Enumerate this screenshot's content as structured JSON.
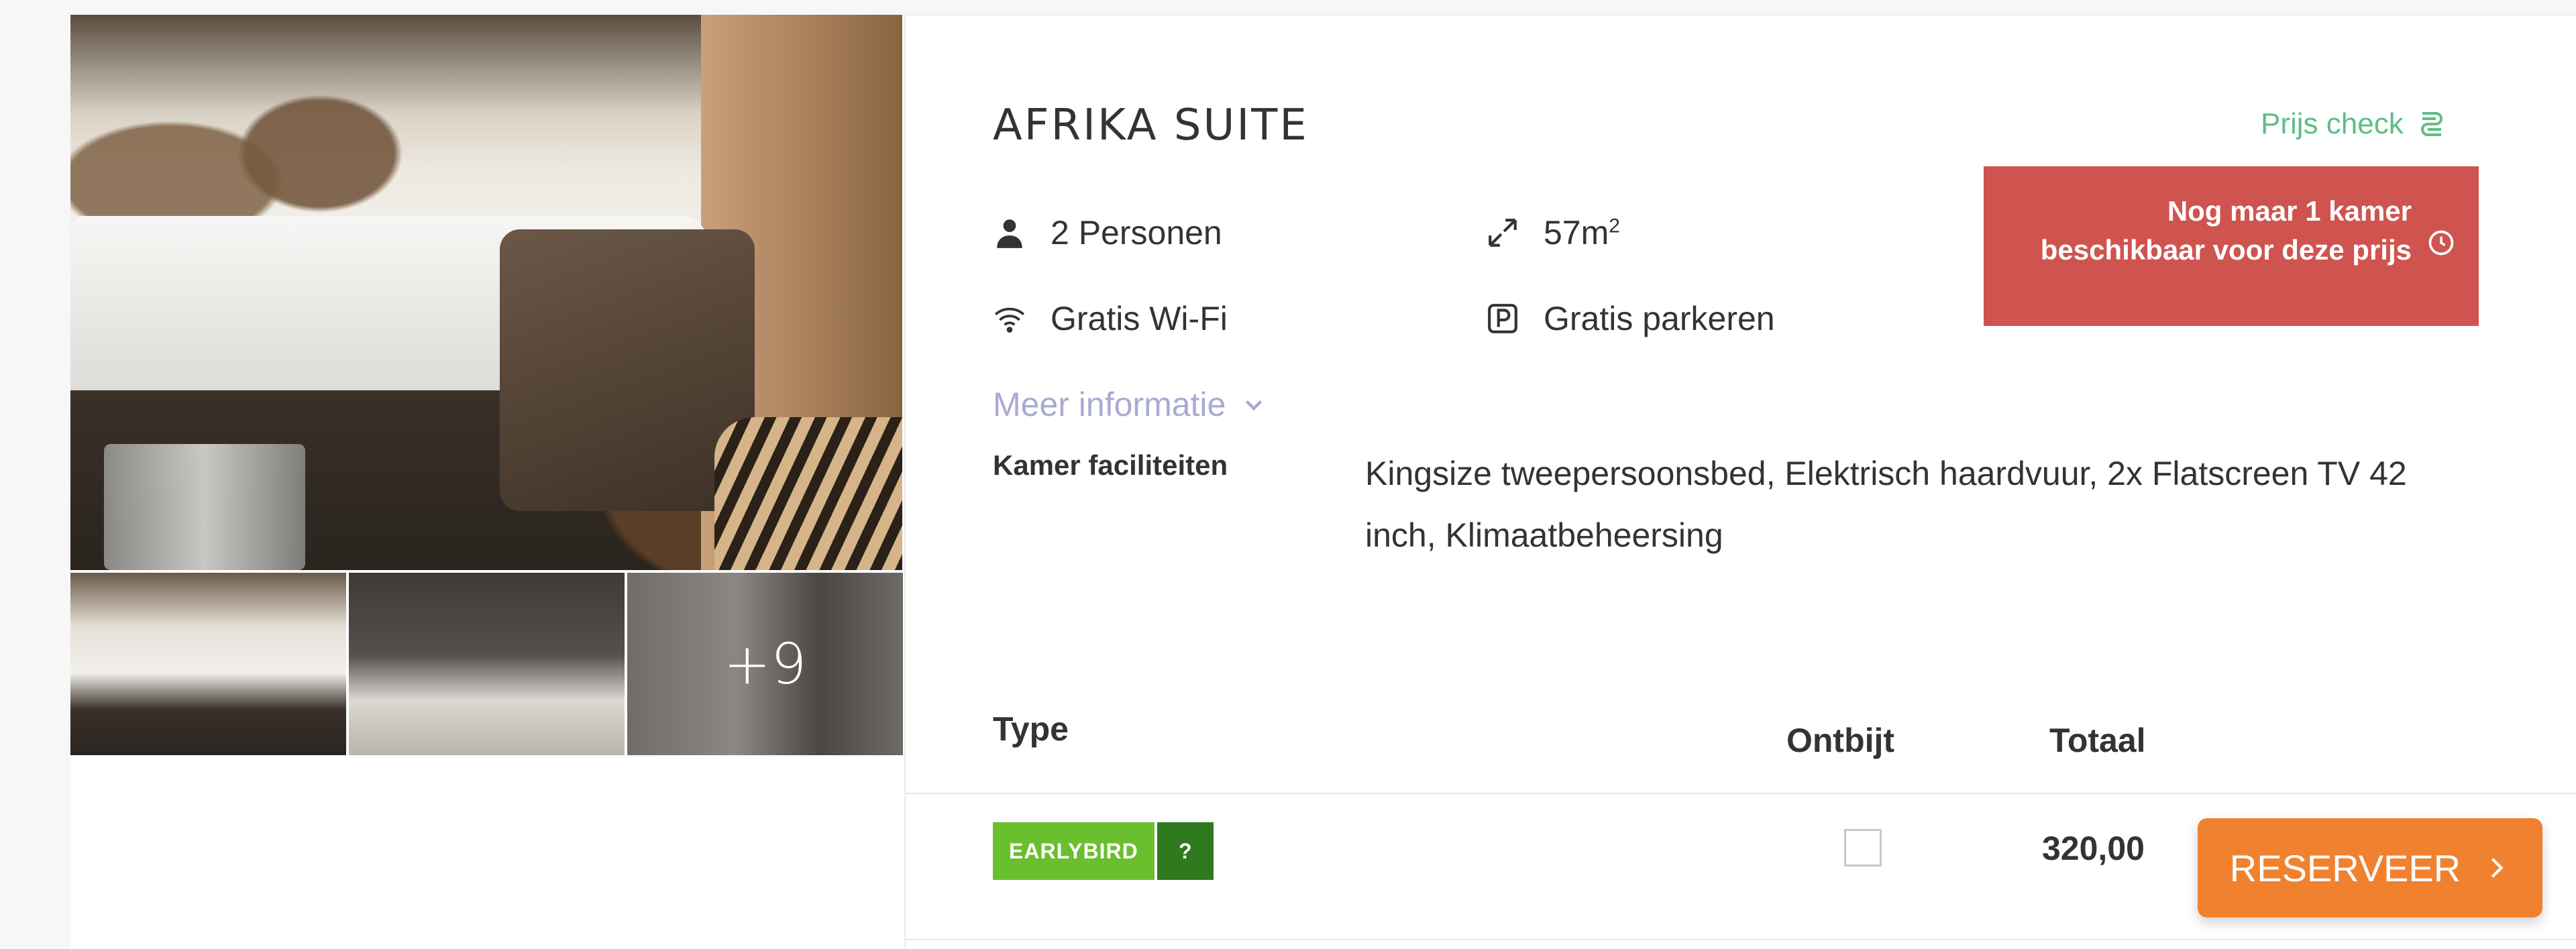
{
  "room": {
    "title": "AFRIKA SUITE",
    "more_photos": "+9",
    "features": {
      "persons": "2 Personen",
      "size_prefix": "57m",
      "size_sup": "2",
      "wifi": "Gratis Wi-Fi",
      "parking": "Gratis parkeren"
    },
    "more_info": "Meer informatie",
    "facilities_label": "Kamer faciliteiten",
    "facilities_value": "Kingsize tweepersoonsbed, Elektrisch haardvuur, 2x Flatscreen TV 42 inch, Klimaatbeheersing"
  },
  "price_check": {
    "label": "Prijs check"
  },
  "availability_alert": {
    "text": "Nog maar 1 kamer beschikbaar voor deze prijs"
  },
  "rates_table": {
    "headers": {
      "type": "Type",
      "breakfast": "Ontbijt",
      "total": "Totaal"
    },
    "rows": [
      {
        "type_badge": "EARLYBIRD",
        "help": "?",
        "breakfast_checked": false,
        "total": "320,00",
        "action": "RESERVEER"
      }
    ]
  },
  "colors": {
    "accent_green": "#5cbf84",
    "alert_red": "#cf5450",
    "badge_green": "#6abf2e",
    "badge_dark_green": "#2f7a1e",
    "cta_orange": "#f0812f",
    "link_lavender": "#a9a9d3"
  },
  "icons": {
    "persons": "person-icon",
    "size": "expand-arrows-icon",
    "wifi": "wifi-icon",
    "parking": "parking-icon",
    "price_check": "price-tag-icon",
    "alert": "clock-icon",
    "more_info": "chevron-down-icon",
    "cta": "chevron-right-icon"
  }
}
